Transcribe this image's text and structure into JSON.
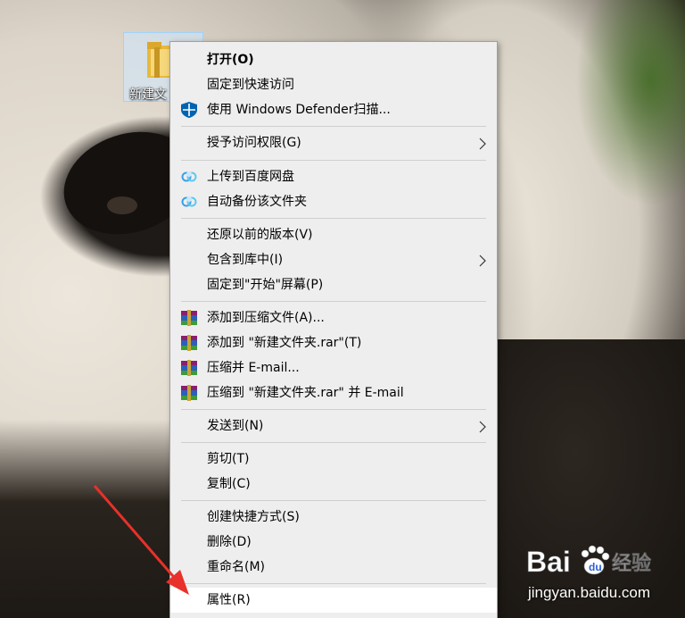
{
  "desktop": {
    "icon_label": "新建文"
  },
  "context_menu": {
    "items": [
      {
        "label": "打开(O)",
        "icon": "none"
      },
      {
        "label": "固定到快速访问",
        "icon": "none"
      },
      {
        "label": "使用 Windows Defender扫描...",
        "icon": "windows-defender-shield-icon"
      },
      {
        "label": "授予访问权限(G)",
        "icon": "none",
        "submenu": true
      },
      {
        "label": "上传到百度网盘",
        "icon": "baidu-netdisk-icon"
      },
      {
        "label": "自动备份该文件夹",
        "icon": "baidu-netdisk-icon"
      },
      {
        "label": "还原以前的版本(V)",
        "icon": "none"
      },
      {
        "label": "包含到库中(I)",
        "icon": "none",
        "submenu": true
      },
      {
        "label": "固定到\"开始\"屏幕(P)",
        "icon": "none"
      },
      {
        "label": "添加到压缩文件(A)...",
        "icon": "winrar-icon"
      },
      {
        "label": "添加到 \"新建文件夹.rar\"(T)",
        "icon": "winrar-icon"
      },
      {
        "label": "压缩并 E-mail...",
        "icon": "winrar-icon"
      },
      {
        "label": "压缩到 \"新建文件夹.rar\" 并 E-mail",
        "icon": "winrar-icon"
      },
      {
        "label": "发送到(N)",
        "icon": "none",
        "submenu": true
      },
      {
        "label": "剪切(T)",
        "icon": "none"
      },
      {
        "label": "复制(C)",
        "icon": "none"
      },
      {
        "label": "创建快捷方式(S)",
        "icon": "none"
      },
      {
        "label": "删除(D)",
        "icon": "none"
      },
      {
        "label": "重命名(M)",
        "icon": "none"
      },
      {
        "label": "属性(R)",
        "icon": "none",
        "hovered": true
      }
    ]
  },
  "watermark": {
    "logo_text": "Bai 经验",
    "url": "jingyan.baidu.com"
  },
  "colors": {
    "menu_background": "#eeeeee",
    "menu_border": "#a0a0a0",
    "hover_background": "#ffffff",
    "selection_highlight": "#cde8ff",
    "annotation_arrow": "#e8312a",
    "defender_blue": "#0063b1"
  }
}
